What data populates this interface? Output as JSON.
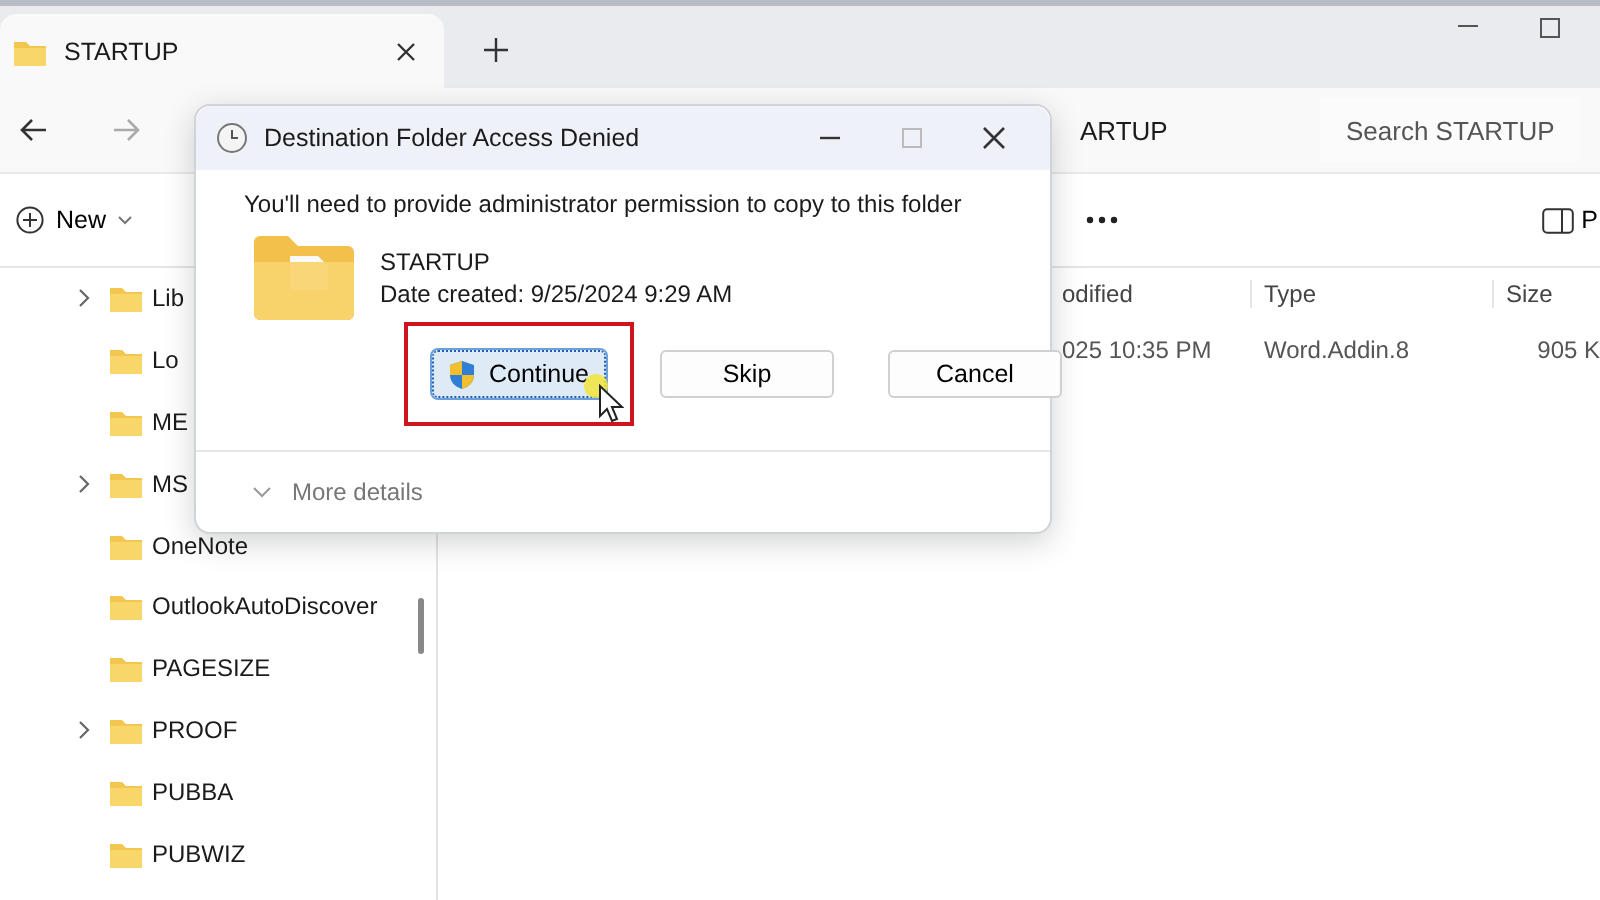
{
  "explorer": {
    "tab": {
      "title": "STARTUP"
    },
    "address": {
      "text": "ARTUP"
    },
    "search": {
      "placeholder": "Search STARTUP"
    },
    "toolbar": {
      "new_label": "New",
      "pane_label": "P"
    },
    "sidebar": {
      "items": [
        {
          "label": "Lib",
          "expandable": true
        },
        {
          "label": "Lo",
          "expandable": false
        },
        {
          "label": "ME",
          "expandable": false
        },
        {
          "label": "MS",
          "expandable": true
        },
        {
          "label": "OneNote",
          "expandable": false
        },
        {
          "label": "OutlookAutoDiscover",
          "expandable": false
        },
        {
          "label": "PAGESIZE",
          "expandable": false
        },
        {
          "label": "PROOF",
          "expandable": true
        },
        {
          "label": "PUBBA",
          "expandable": false
        },
        {
          "label": "PUBWIZ",
          "expandable": false
        }
      ]
    },
    "file_list": {
      "columns": [
        "odified",
        "Type",
        "Size"
      ],
      "rows": [
        [
          "025 10:35 PM",
          "Word.Addin.8",
          "905 K"
        ]
      ]
    }
  },
  "dialog": {
    "title": "Destination Folder Access Denied",
    "message": "You'll need to provide administrator permission to copy to this folder",
    "item_name": "STARTUP",
    "item_date": "Date created: 9/25/2024 9:29 AM",
    "buttons": [
      {
        "label": "Continue",
        "kind": "shield",
        "focused": true,
        "highlighted": true
      },
      {
        "label": "Skip",
        "kind": "plain",
        "focused": false,
        "highlighted": false
      },
      {
        "label": "Cancel",
        "kind": "plain",
        "focused": false,
        "highlighted": false
      }
    ],
    "details_label": "More details"
  }
}
